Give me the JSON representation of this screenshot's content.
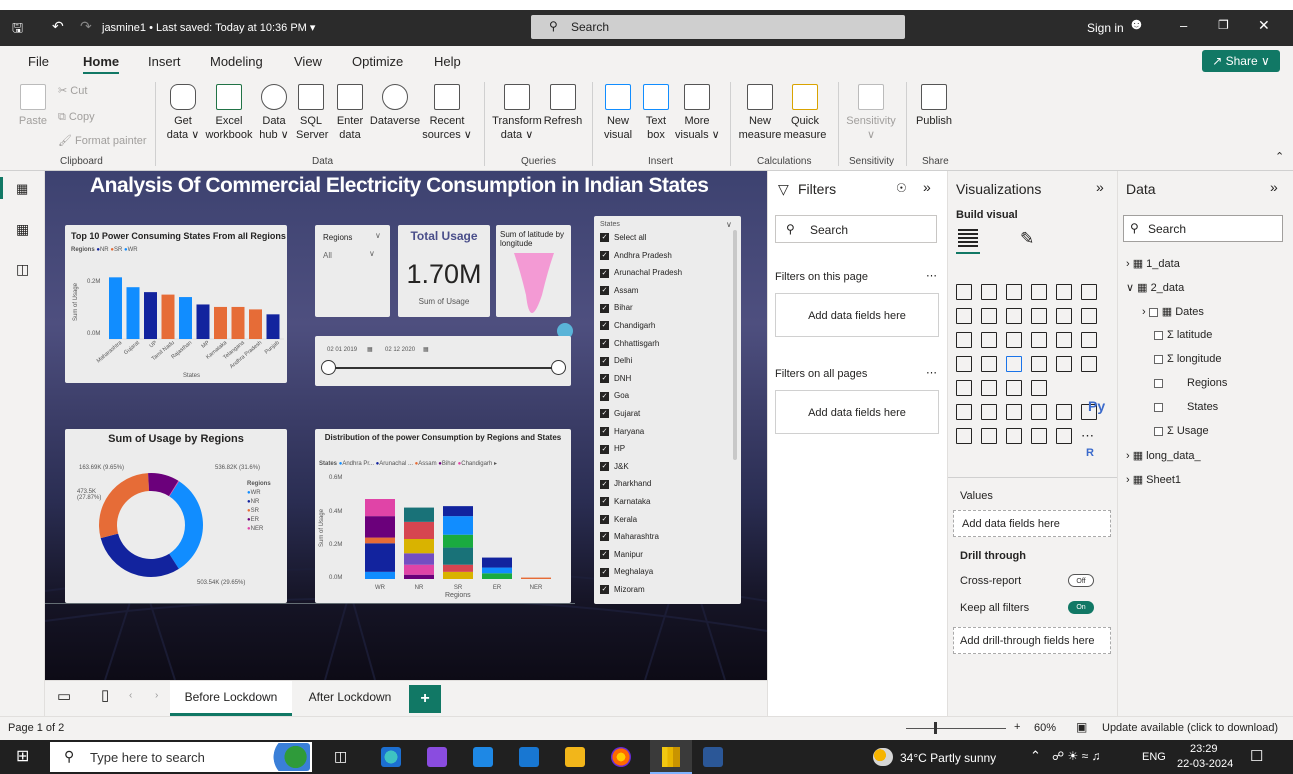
{
  "window": {
    "title": "jasmine1 • Last saved: Today at 10:36 PM ▾",
    "search": "Search",
    "sign_in": "Sign in"
  },
  "menu": {
    "items": [
      "File",
      "Home",
      "Insert",
      "Modeling",
      "View",
      "Optimize",
      "Help"
    ],
    "share": "Share ∨"
  },
  "ribbon": {
    "paste": "Paste",
    "cut": "Cut",
    "copy": "Copy",
    "format_painter": "Format painter",
    "clipboard": "Clipboard",
    "get_data": "Get\ndata ∨",
    "excel": "Excel\nworkbook",
    "data_hub": "Data\nhub ∨",
    "sql": "SQL\nServer",
    "enter_data": "Enter\ndata",
    "dataverse": "Dataverse",
    "recent": "Recent\nsources ∨",
    "data": "Data",
    "transform": "Transform\ndata ∨",
    "refresh": "Refresh",
    "queries": "Queries",
    "new_visual": "New\nvisual",
    "text_box": "Text\nbox",
    "more_visuals": "More\nvisuals ∨",
    "insert": "Insert",
    "new_measure": "New\nmeasure",
    "quick_measure": "Quick\nmeasure",
    "calculations": "Calculations",
    "sensitivity_btn": "Sensitivity\n∨",
    "sensitivity": "Sensitivity",
    "publish": "Publish",
    "share": "Share"
  },
  "report": {
    "title": "Analysis Of Commercial Electricity Consumption in Indian States",
    "bar1": {
      "title": "Top 10 Power Consuming States From all Regions",
      "legend_label": "Regions",
      "legend": [
        "NR",
        "SR",
        "WR"
      ],
      "xlabel": "States",
      "ylabel": "Sum of Usage",
      "yticks": [
        "0.2M",
        "0.0M"
      ]
    },
    "slicer": {
      "label": "Regions",
      "value": "All"
    },
    "card": {
      "title": "Total Usage",
      "value": "1.70M",
      "label": "Sum of Usage"
    },
    "funnel": {
      "title": "Sum of latitude by longitude"
    },
    "date_slicer": {
      "from": "02 01 2019",
      "to": "02 12 2020"
    },
    "donut": {
      "title": "Sum of Usage by Regions",
      "legend_label": "Regions",
      "labels": [
        "163.69K (9.65%)",
        "536.82K (31.6%)",
        "473.5K (27.87%)",
        "503.54K (29.65%)"
      ]
    },
    "stacked": {
      "title": "Distribution of the power Consumption by Regions and States",
      "legend_label": "States",
      "legend": [
        "Andhra Pr...",
        "Arunachal ...",
        "Assam",
        "Bihar",
        "Chandigarh"
      ],
      "xlabel": "Regions",
      "ylabel": "Sum of Usage",
      "yticks": [
        "0.6M",
        "0.4M",
        "0.2M",
        "0.0M"
      ]
    },
    "states": {
      "title": "States",
      "items": [
        "Select all",
        "Andhra Pradesh",
        "Arunachal Pradesh",
        "Assam",
        "Bihar",
        "Chandigarh",
        "Chhattisgarh",
        "Delhi",
        "DNH",
        "Goa",
        "Gujarat",
        "Haryana",
        "HP",
        "J&K",
        "Jharkhand",
        "Karnataka",
        "Kerala",
        "Maharashtra",
        "Manipur",
        "Meghalaya",
        "Mizoram"
      ]
    }
  },
  "chart_data": [
    {
      "type": "bar",
      "title": "Top 10 Power Consuming States From all Regions",
      "categories": [
        "Maharashtra",
        "Gujarat",
        "UP",
        "Tamil Nadu",
        "Rajasthan",
        "MP",
        "Karnataka",
        "Telangana",
        "Andhra Pradesh",
        "Punjab"
      ],
      "values": [
        0.25,
        0.21,
        0.19,
        0.18,
        0.17,
        0.14,
        0.13,
        0.13,
        0.12,
        0.1
      ],
      "colors": [
        "#118DFF",
        "#118DFF",
        "#12239E",
        "#E66C37",
        "#118DFF",
        "#12239E",
        "#E66C37",
        "#E66C37",
        "#E66C37",
        "#12239E"
      ],
      "xlabel": "States",
      "ylabel": "Sum of Usage",
      "ylim": [
        0,
        0.3
      ]
    },
    {
      "type": "pie",
      "title": "Sum of Usage by Regions",
      "categories": [
        "WR",
        "NR",
        "SR",
        "ER",
        "NER"
      ],
      "values": [
        536.82,
        503.54,
        473.5,
        163.69,
        4.0
      ],
      "colors": [
        "#118DFF",
        "#12239E",
        "#E66C37",
        "#6B007B",
        "#E044A7"
      ]
    },
    {
      "type": "bar",
      "title": "Distribution of the power Consumption by Regions and States",
      "categories": [
        "WR",
        "NR",
        "SR",
        "ER",
        "NER"
      ],
      "series_colors": [
        "#118DFF",
        "#12239E",
        "#E66C37",
        "#6B007B",
        "#E044A7",
        "#744EC2",
        "#D9B300",
        "#D64550",
        "#197278",
        "#1AAB40"
      ],
      "stacks": [
        [
          0.05,
          0.2,
          0.04,
          0.15,
          0.12
        ],
        [
          0.03,
          0.07,
          0.08,
          0.1,
          0.12,
          0.1
        ],
        [
          0.05,
          0.05,
          0.12,
          0.09,
          0.13,
          0.07
        ],
        [
          0.04,
          0.04,
          0.07
        ],
        [
          0.01
        ]
      ],
      "xlabel": "Regions",
      "ylabel": "Sum of Usage",
      "ylim": [
        0,
        0.7
      ]
    }
  ],
  "filters": {
    "title": "Filters",
    "search": "Search",
    "on_page": "Filters on this page",
    "on_all": "Filters on all pages",
    "add": "Add data fields here"
  },
  "visualizations": {
    "title": "Visualizations",
    "build": "Build visual",
    "values": "Values",
    "add_fields": "Add data fields here",
    "drill": "Drill through",
    "cross_report": "Cross-report",
    "cross_state": "Off",
    "keep_filters": "Keep all filters",
    "keep_state": "On",
    "add_drill": "Add drill-through fields here",
    "r": "R",
    "py": "Py"
  },
  "data_pane": {
    "title": "Data",
    "search": "Search",
    "tables": [
      "1_data",
      "2_data",
      "long_data_",
      "Sheet1"
    ],
    "fields": [
      "Dates",
      "latitude",
      "longitude",
      "Regions",
      "States",
      "Usage"
    ]
  },
  "tabs": {
    "t1": "Before Lockdown",
    "t2": "After Lockdown",
    "add": "+"
  },
  "status": {
    "page": "Page 1 of 2",
    "zoom": "60%",
    "update": "Update available (click to download)"
  },
  "taskbar": {
    "search": "Type here to search",
    "weather": "34°C  Partly sunny",
    "lang": "ENG",
    "time": "23:29",
    "date": "22-03-2024"
  }
}
